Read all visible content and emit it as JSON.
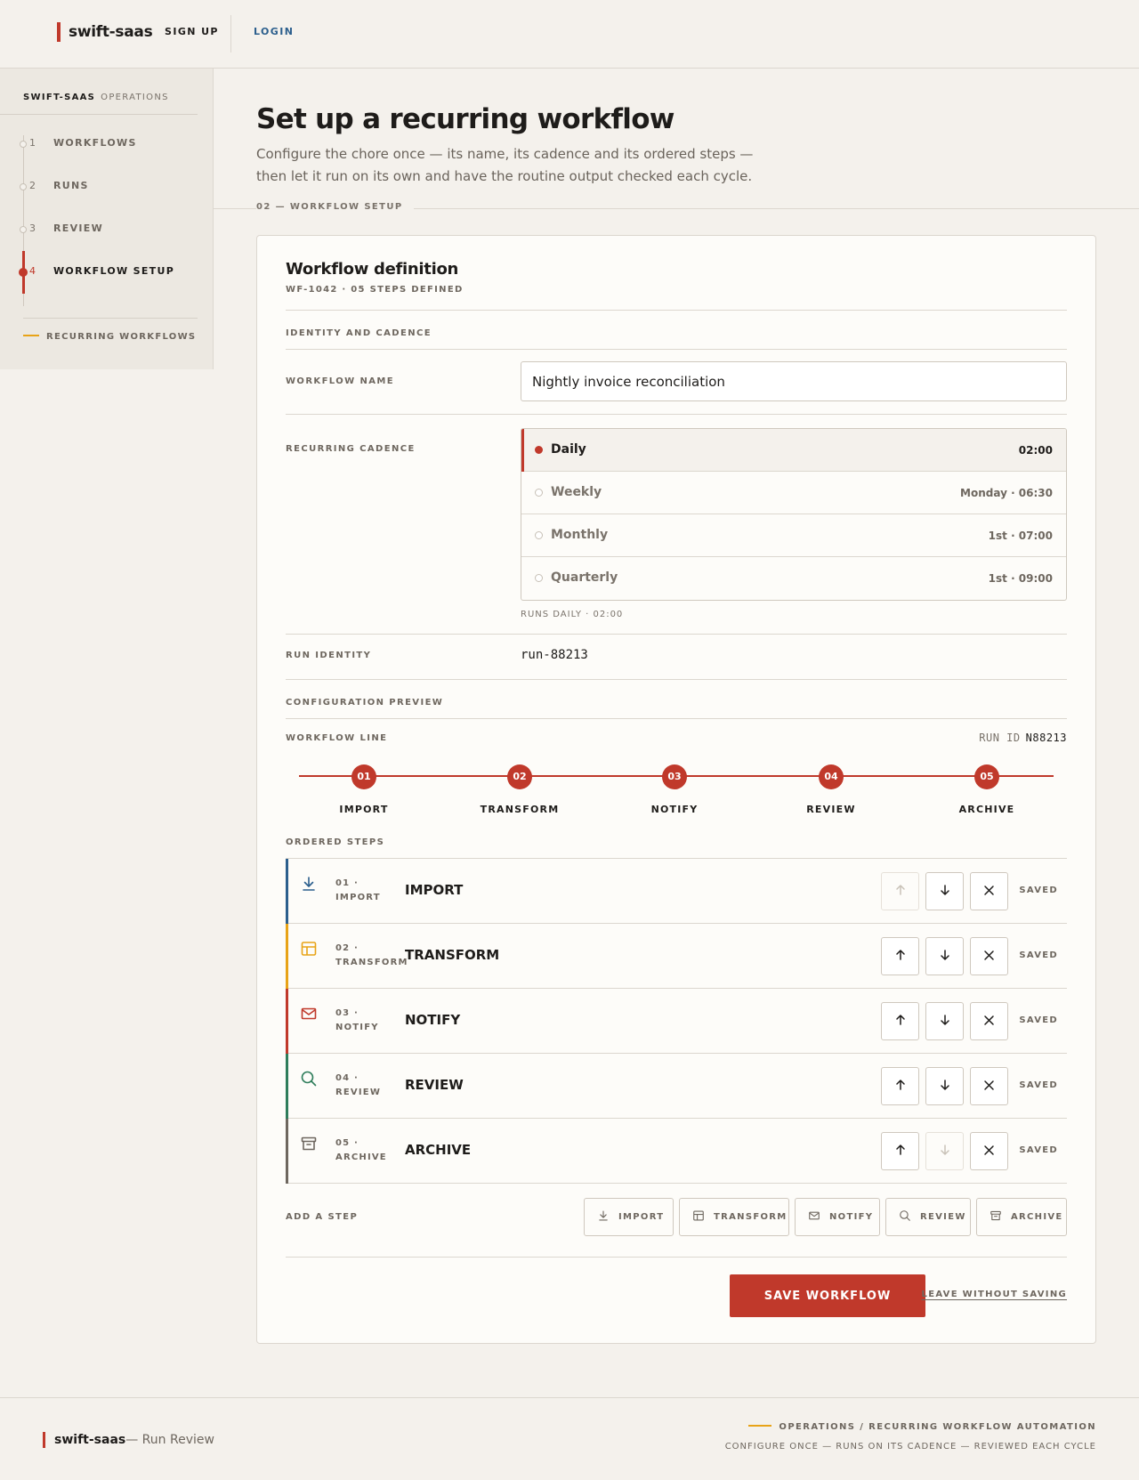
{
  "app": {
    "brand": "swift-saas",
    "nav": {
      "signup": "SIGN UP",
      "login": "LOGIN"
    }
  },
  "sidebar": {
    "brand": "SWIFT-SAAS",
    "section": "OPERATIONS",
    "items": [
      {
        "num": "1",
        "label": "WORKFLOWS"
      },
      {
        "num": "2",
        "label": "RUNS"
      },
      {
        "num": "3",
        "label": "REVIEW"
      },
      {
        "num": "4",
        "label": "WORKFLOW SETUP"
      }
    ],
    "active_index": 3,
    "footer": "RECURRING WORKFLOWS"
  },
  "header": {
    "title": "Set up a recurring workflow",
    "lead": "Configure the chore once — its name, its cadence and its ordered steps — then let it run on its own and have the routine output checked each cycle.",
    "section_label": "02 — WORKFLOW SETUP"
  },
  "card": {
    "title": "Workflow definition",
    "subtitle": "WF-1042 · 05 STEPS DEFINED",
    "identity_group": "IDENTITY AND CADENCE",
    "name_label": "WORKFLOW NAME",
    "name_value": "Nightly invoice reconciliation",
    "cadence_label": "RECURRING CADENCE",
    "cadence_options": [
      {
        "name": "Daily",
        "time": "02:00"
      },
      {
        "name": "Weekly",
        "time": "Monday · 06:30"
      },
      {
        "name": "Monthly",
        "time": "1st · 07:00"
      },
      {
        "name": "Quarterly",
        "time": "1st · 09:00"
      }
    ],
    "cadence_selected": "Daily",
    "cadence_note": "RUNS DAILY · 02:00",
    "run_identity_label": "RUN IDENTITY",
    "run_identity_value": "run-88213",
    "preview_group": "CONFIGURATION PREVIEW",
    "workflow_line_label": "WORKFLOW LINE",
    "run_id_key": "RUN ID",
    "run_id_value": "N88213",
    "pipeline": [
      {
        "num": "01",
        "label": "IMPORT"
      },
      {
        "num": "02",
        "label": "TRANSFORM"
      },
      {
        "num": "03",
        "label": "NOTIFY"
      },
      {
        "num": "04",
        "label": "REVIEW"
      },
      {
        "num": "05",
        "label": "ARCHIVE"
      }
    ],
    "ordered_steps_label": "ORDERED STEPS",
    "steps": [
      {
        "code1": "01 ·",
        "code2": "IMPORT",
        "title": "IMPORT",
        "status": "SAVED",
        "icon": "download-icon",
        "color": "#2c5f8d"
      },
      {
        "code1": "02 ·",
        "code2": "TRANSFORM",
        "title": "TRANSFORM",
        "status": "SAVED",
        "icon": "table-icon",
        "color": "#e8a317"
      },
      {
        "code1": "03 ·",
        "code2": "NOTIFY",
        "title": "NOTIFY",
        "status": "SAVED",
        "icon": "mail-icon",
        "color": "#c0392b"
      },
      {
        "code1": "04 ·",
        "code2": "REVIEW",
        "title": "REVIEW",
        "status": "SAVED",
        "icon": "search-icon",
        "color": "#2e7d5b"
      },
      {
        "code1": "05 ·",
        "code2": "ARCHIVE",
        "title": "ARCHIVE",
        "status": "SAVED",
        "icon": "archive-icon",
        "color": "#6e675f"
      }
    ],
    "add_step_label": "ADD A STEP",
    "add_step_options": [
      "IMPORT",
      "TRANSFORM",
      "NOTIFY",
      "REVIEW",
      "ARCHIVE"
    ],
    "save_label": "SAVE WORKFLOW",
    "leave_label": "LEAVE WITHOUT SAVING"
  },
  "footer": {
    "brand": "swift-saas",
    "subtitle": "— Run Review",
    "line1": "OPERATIONS / RECURRING WORKFLOW AUTOMATION",
    "line2": "CONFIGURE ONCE — RUNS ON ITS CADENCE — REVIEWED EACH CYCLE"
  },
  "colors": {
    "accent": "#c0392b",
    "yellow": "#e8a317",
    "blue": "#2c5f8d",
    "green": "#2e7d5b"
  }
}
